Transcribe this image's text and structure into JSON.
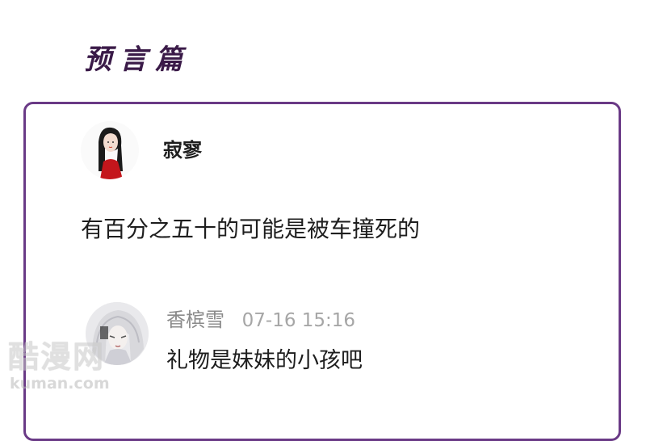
{
  "section_title": "预言篇",
  "post": {
    "author": "寂寥",
    "avatar_icon": "girl-portrait-avatar-icon",
    "text": "有百分之五十的可能是被车撞死的"
  },
  "reply": {
    "author": "香槟雪",
    "timestamp": "07-16 15:16",
    "avatar_icon": "white-hair-portrait-avatar-icon",
    "text": "礼物是妹妹的小孩吧"
  },
  "watermark": {
    "cn": "酷漫网",
    "en": "kuman.com"
  },
  "colors": {
    "accent": "#6a3a86",
    "title": "#3a1a48",
    "muted_text": "#8a8a8a"
  }
}
